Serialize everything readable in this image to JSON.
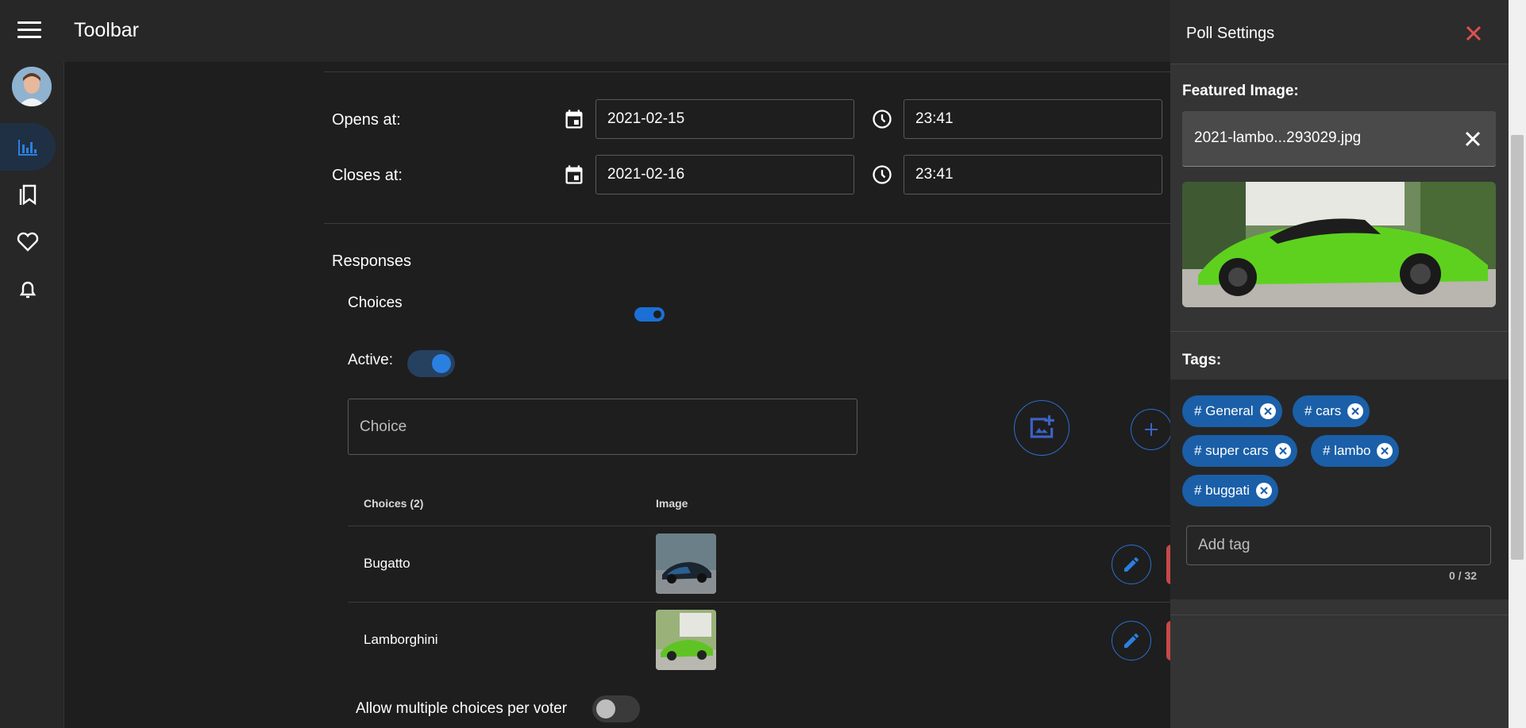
{
  "app": {
    "title": "Toolbar"
  },
  "dates": {
    "opens_label": "Opens at:",
    "opens_date": "2021-02-15",
    "opens_time": "23:41",
    "closes_label": "Closes at:",
    "closes_date": "2021-02-16",
    "closes_time": "23:41"
  },
  "responses": {
    "heading": "Responses",
    "choices_label": "Choices",
    "active_label": "Active:",
    "choice_placeholder": "Choice",
    "table_headers": [
      "Choices (2)",
      "Image"
    ],
    "rows": [
      {
        "name": "Bugatto"
      },
      {
        "name": "Lamborghini"
      }
    ],
    "multiple_label": "Allow multiple choices per voter"
  },
  "panel": {
    "title": "Poll Settings",
    "featured_label": "Featured Image:",
    "file_name": "2021-lambo...293029.jpg",
    "tags_label": "Tags:",
    "tags": [
      "# General",
      "# cars",
      "# super cars",
      "# lambo",
      "# buggati"
    ],
    "add_tag_placeholder": "Add tag",
    "counter": "0 / 32"
  },
  "colors": {
    "accent": "#2a6fd1",
    "chip": "#1a5fa8",
    "close": "#e05050"
  }
}
